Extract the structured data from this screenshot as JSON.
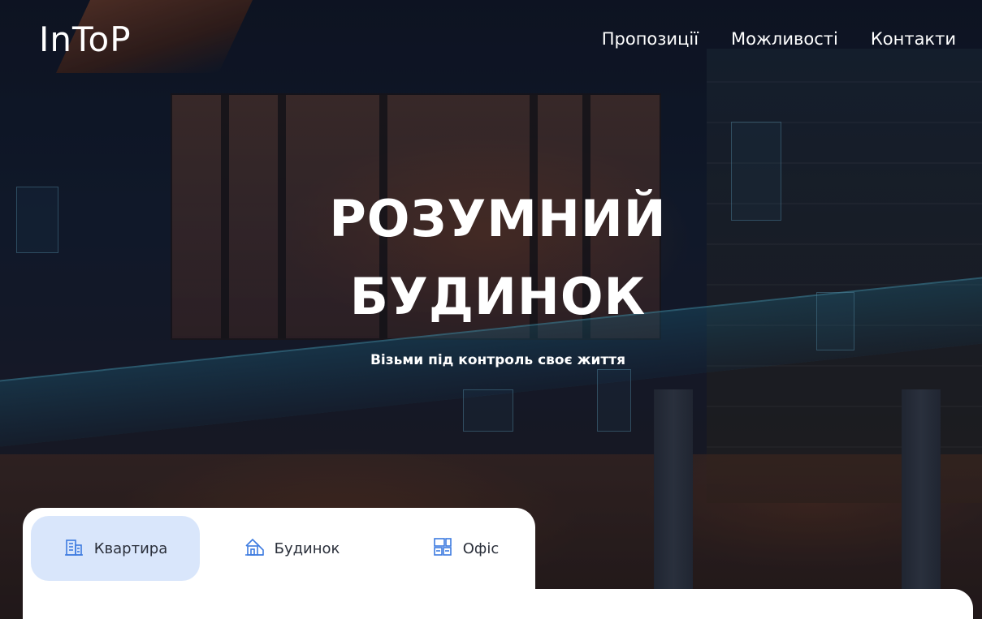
{
  "header": {
    "logo": "InToP",
    "nav": [
      {
        "label": "Пропозиції"
      },
      {
        "label": "Можливості"
      },
      {
        "label": "Контакти"
      }
    ]
  },
  "hero": {
    "title_line1": "РОЗУМНИЙ",
    "title_line2": "БУДИНОК",
    "tagline": "Візьми під контроль своє життя"
  },
  "tabs": [
    {
      "label": "Квартира",
      "icon": "apartment-building-icon",
      "active": true
    },
    {
      "label": "Будинок",
      "icon": "house-icon",
      "active": false
    },
    {
      "label": "Офіс",
      "icon": "office-icon",
      "active": false
    }
  ],
  "colors": {
    "accent_tab_bg": "#d9e6fb",
    "icon_blue": "#3d7be0",
    "text_white": "#ffffff"
  }
}
